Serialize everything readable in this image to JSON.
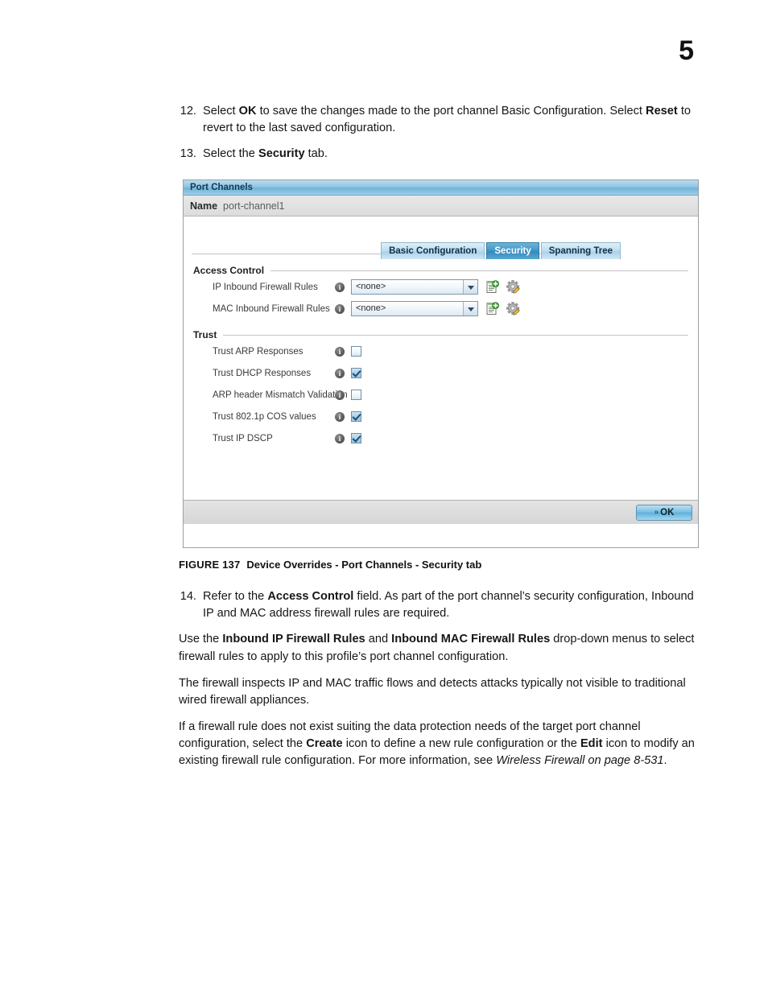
{
  "page": {
    "number": "5"
  },
  "steps_upper": [
    {
      "num": "12.",
      "parts": [
        {
          "t": "Select ",
          "s": "n"
        },
        {
          "t": "OK",
          "s": "b"
        },
        {
          "t": " to save the changes made to the port channel Basic Configuration. Select ",
          "s": "n"
        },
        {
          "t": "Reset",
          "s": "b"
        },
        {
          "t": " to revert to the last saved configuration.",
          "s": "n"
        }
      ]
    },
    {
      "num": "13.",
      "parts": [
        {
          "t": "Select the ",
          "s": "n"
        },
        {
          "t": "Security",
          "s": "b"
        },
        {
          "t": " tab.",
          "s": "n"
        }
      ]
    }
  ],
  "panel": {
    "title": "Port Channels",
    "name_label": "Name",
    "name_value": "port-channel1",
    "tabs": [
      {
        "label": "Basic Configuration",
        "active": false
      },
      {
        "label": "Security",
        "active": true
      },
      {
        "label": "Spanning Tree",
        "active": false
      }
    ],
    "access_control": {
      "heading": "Access Control",
      "rows": [
        {
          "label": "IP Inbound Firewall Rules",
          "info_glyph": "i",
          "value": "<none>",
          "create_icon": "create-icon",
          "edit_icon": "edit-icon"
        },
        {
          "label": "MAC Inbound Firewall Rules",
          "info_glyph": "i",
          "value": "<none>",
          "create_icon": "create-icon",
          "edit_icon": "edit-icon"
        }
      ]
    },
    "trust": {
      "heading": "Trust",
      "rows": [
        {
          "label": "Trust ARP Responses",
          "info_glyph": "i",
          "checked": false
        },
        {
          "label": "Trust DHCP Responses",
          "info_glyph": "i",
          "checked": true
        },
        {
          "label": "ARP header Mismatch Validation",
          "info_glyph": "i",
          "checked": false
        },
        {
          "label": "Trust 802.1p COS values",
          "info_glyph": "i",
          "checked": true
        },
        {
          "label": "Trust IP DSCP",
          "info_glyph": "i",
          "checked": true
        }
      ]
    },
    "footer": {
      "ok_label": "OK",
      "ok_chevron": "»"
    }
  },
  "figure": {
    "number": "FIGURE 137",
    "caption": "Device Overrides - Port Channels - Security tab"
  },
  "steps_lower": [
    {
      "type": "step",
      "num": "14.",
      "parts": [
        {
          "t": "Refer to the ",
          "s": "n"
        },
        {
          "t": "Access Control",
          "s": "b"
        },
        {
          "t": " field. As part of the port channel’s security configuration, Inbound IP and MAC address firewall rules are required.",
          "s": "n"
        }
      ]
    },
    {
      "type": "para",
      "parts": [
        {
          "t": "Use the ",
          "s": "n"
        },
        {
          "t": "Inbound IP Firewall Rules",
          "s": "b"
        },
        {
          "t": " and ",
          "s": "n"
        },
        {
          "t": "Inbound MAC Firewall Rules",
          "s": "b"
        },
        {
          "t": " drop-down menus to select firewall rules to apply to this profile’s port channel configuration.",
          "s": "n"
        }
      ]
    },
    {
      "type": "para",
      "parts": [
        {
          "t": "The firewall inspects IP and MAC traffic flows and detects attacks typically not visible to traditional wired firewall appliances.",
          "s": "n"
        }
      ]
    },
    {
      "type": "para",
      "parts": [
        {
          "t": "If a firewall rule does not exist suiting the data protection needs of the target port channel configuration, select the ",
          "s": "n"
        },
        {
          "t": "Create",
          "s": "b"
        },
        {
          "t": " icon to define a new rule configuration or the ",
          "s": "n"
        },
        {
          "t": "Edit",
          "s": "b"
        },
        {
          "t": " icon to modify an existing firewall rule configuration. For more information, see ",
          "s": "n"
        },
        {
          "t": "Wireless Firewall on page 8-531",
          "s": "i"
        },
        {
          "t": ".",
          "s": "n"
        }
      ]
    }
  ]
}
